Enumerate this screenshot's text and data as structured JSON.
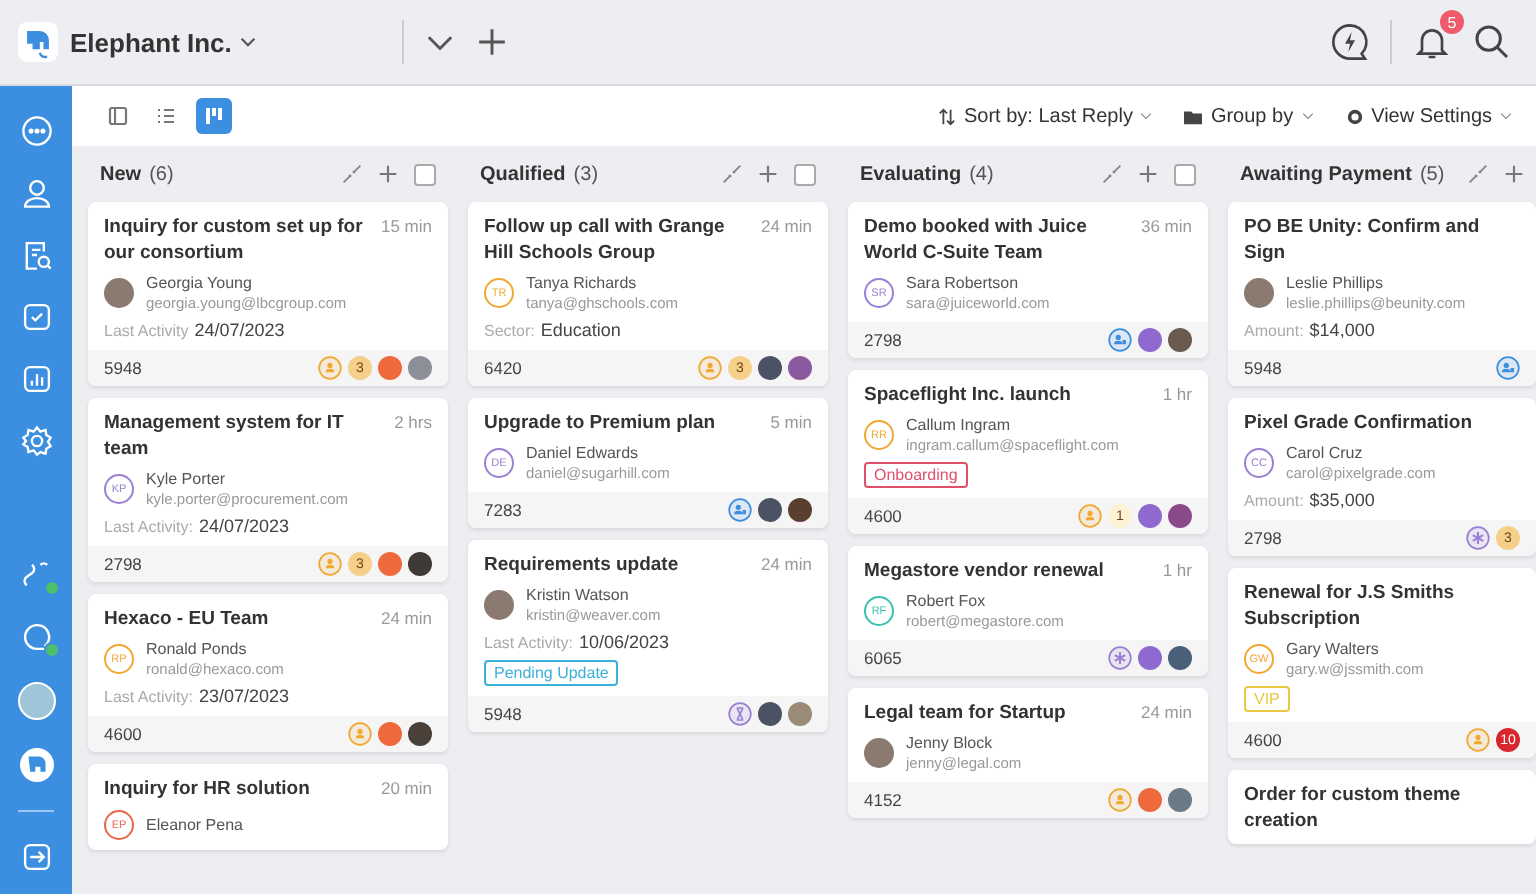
{
  "workspace": {
    "name": "Elephant Inc."
  },
  "notifications": {
    "count": "5"
  },
  "toolbar": {
    "views": [
      {
        "kind": "panel",
        "selected": false
      },
      {
        "kind": "list",
        "selected": false
      },
      {
        "kind": "board",
        "selected": true
      }
    ],
    "sort": "Sort by: Last Reply",
    "group": "Group by",
    "settings": "View Settings"
  },
  "sidebar": {
    "items": [
      {
        "kind": "chat",
        "selected": false
      },
      {
        "kind": "user",
        "selected": false
      },
      {
        "kind": "search-doc",
        "selected": false
      },
      {
        "kind": "check",
        "selected": false
      },
      {
        "kind": "chart",
        "selected": false
      },
      {
        "kind": "gear",
        "selected": false
      }
    ],
    "bottom": [
      {
        "kind": "link",
        "online": true
      },
      {
        "kind": "chat",
        "online": true
      },
      {
        "kind": "avatar",
        "online": false
      },
      {
        "kind": "logo",
        "online": false
      }
    ]
  },
  "columns": [
    {
      "title": "New",
      "count": "(6)",
      "checked": false,
      "cards": [
        {
          "title": "Inquiry for custom set up for our consortium",
          "time": "15 min",
          "contact": {
            "kind": "photo",
            "name": "Georgia Young",
            "email": "georgia.young@lbcgroup.com"
          },
          "meta": {
            "label": "Last Activity",
            "value": "24/07/2023"
          },
          "id": "5948",
          "badges": [
            {
              "kind": "person",
              "color": "#f0a830"
            },
            {
              "kind": "count",
              "text": "3",
              "color": "#f6d08a"
            },
            {
              "kind": "avatar",
              "color": "#ee6a3c"
            },
            {
              "kind": "photo",
              "color": "#8a8f98"
            }
          ]
        },
        {
          "title": "Management system for IT team",
          "time": "2 hrs",
          "contact": {
            "kind": "initials",
            "initials": "KP",
            "color": "#9b7fd4",
            "name": "Kyle Porter",
            "email": "kyle.porter@procurement.com"
          },
          "meta": {
            "label": "Last Activity:",
            "value": "24/07/2023"
          },
          "id": "2798",
          "badges": [
            {
              "kind": "person",
              "color": "#f0a830"
            },
            {
              "kind": "count",
              "text": "3",
              "color": "#f6d08a"
            },
            {
              "kind": "avatar",
              "color": "#ee6a3c"
            },
            {
              "kind": "photo",
              "color": "#3e3a38"
            }
          ]
        },
        {
          "title": "Hexaco - EU Team",
          "time": "24 min",
          "contact": {
            "kind": "initials",
            "initials": "RP",
            "color": "#f0a830",
            "name": "Ronald Ponds",
            "email": "ronald@hexaco.com"
          },
          "meta": {
            "label": "Last Activity:",
            "value": "23/07/2023"
          },
          "id": "4600",
          "badges": [
            {
              "kind": "person",
              "color": "#f0a830"
            },
            {
              "kind": "avatar",
              "color": "#ee6a3c"
            },
            {
              "kind": "photo",
              "color": "#4a4038"
            }
          ]
        },
        {
          "title": "Inquiry for HR solution",
          "time": "20 min",
          "contact": {
            "kind": "initials",
            "initials": "EP",
            "color": "#e8674a",
            "name": "Eleanor Pena"
          }
        }
      ]
    },
    {
      "title": "Qualified",
      "count": "(3)",
      "checked": false,
      "cards": [
        {
          "title": "Follow up call with Grange Hill Schools Group",
          "time": "24 min",
          "contact": {
            "kind": "initials",
            "initials": "TR",
            "color": "#f0a830",
            "name": "Tanya Richards",
            "email": "tanya@ghschools.com"
          },
          "meta": {
            "label": "Sector:",
            "value": "Education"
          },
          "id": "6420",
          "badges": [
            {
              "kind": "person",
              "color": "#f0a830"
            },
            {
              "kind": "count",
              "text": "3",
              "color": "#f6d08a"
            },
            {
              "kind": "avatar",
              "color": "#4a5263"
            },
            {
              "kind": "photo",
              "color": "#8a5aa0"
            }
          ]
        },
        {
          "title": "Upgrade to Premium plan",
          "time": "5 min",
          "contact": {
            "kind": "initials",
            "initials": "DE",
            "color": "#9b7fd4",
            "name": "Daniel Edwards",
            "email": "daniel@sugarhill.com"
          },
          "id": "7283",
          "badges": [
            {
              "kind": "team",
              "color": "#3b8ee0"
            },
            {
              "kind": "avatar",
              "color": "#4a5263"
            },
            {
              "kind": "photo",
              "color": "#5a3e30"
            }
          ]
        },
        {
          "title": "Requirements update",
          "time": "24 min",
          "contact": {
            "kind": "photo",
            "name": "Kristin Watson",
            "email": "kristin@weaver.com"
          },
          "meta": {
            "label": "Last Activity:",
            "value": "10/06/2023"
          },
          "tag": {
            "text": "Pending Update",
            "color": "#3bb0d8"
          },
          "id": "5948",
          "badges": [
            {
              "kind": "hourglass",
              "color": "#9b7fd4"
            },
            {
              "kind": "avatar",
              "color": "#4a5263"
            },
            {
              "kind": "photo",
              "color": "#9a8a78"
            }
          ]
        }
      ]
    },
    {
      "title": "Evaluating",
      "count": "(4)",
      "checked": false,
      "cards": [
        {
          "title": "Demo booked with Juice World C-Suite Team",
          "time": "36 min",
          "contact": {
            "kind": "initials",
            "initials": "SR",
            "color": "#9b7fd4",
            "name": "Sara Robertson",
            "email": "sara@juiceworld.com"
          },
          "id": "2798",
          "badges": [
            {
              "kind": "team",
              "color": "#3b8ee0"
            },
            {
              "kind": "avatar",
              "color": "#8e6ad0"
            },
            {
              "kind": "photo",
              "color": "#6a5a50"
            }
          ]
        },
        {
          "title": "Spaceflight Inc. launch",
          "time": "1 hr",
          "contact": {
            "kind": "initials",
            "initials": "RR",
            "color": "#f0a830",
            "name": "Callum Ingram",
            "email": "ingram.callum@spaceflight.com"
          },
          "tag": {
            "text": "Onboarding",
            "color": "#e0506a"
          },
          "id": "4600",
          "badges": [
            {
              "kind": "person",
              "color": "#f0a830"
            },
            {
              "kind": "count",
              "text": "1",
              "color": "#fdf1d6"
            },
            {
              "kind": "avatar",
              "color": "#8e6ad0"
            },
            {
              "kind": "photo",
              "color": "#8a4a8a"
            }
          ]
        },
        {
          "title": "Megastore vendor renewal",
          "time": "1 hr",
          "contact": {
            "kind": "initials",
            "initials": "RF",
            "color": "#3bbfb0",
            "name": "Robert Fox",
            "email": "robert@megastore.com"
          },
          "id": "6065",
          "badges": [
            {
              "kind": "asterisk",
              "color": "#9b7fd4"
            },
            {
              "kind": "avatar",
              "color": "#8e6ad0"
            },
            {
              "kind": "photo",
              "color": "#4a6078"
            }
          ]
        },
        {
          "title": "Legal team for Startup",
          "time": "24 min",
          "contact": {
            "kind": "photo",
            "name": "Jenny Block",
            "email": "jenny@legal.com"
          },
          "id": "4152",
          "badges": [
            {
              "kind": "person",
              "color": "#f0a830"
            },
            {
              "kind": "avatar",
              "color": "#ee6a3c"
            },
            {
              "kind": "photo",
              "color": "#6a7a88"
            }
          ]
        }
      ]
    },
    {
      "title": "Awaiting Payment",
      "count": "(5)",
      "cards": [
        {
          "title": "PO BE Unity: Confirm and Sign",
          "contact": {
            "kind": "photo",
            "name": "Leslie Phillips",
            "email": "leslie.phillips@beunity.com"
          },
          "meta": {
            "label": "Amount:",
            "value": "$14,000"
          },
          "id": "5948",
          "badges": [
            {
              "kind": "team",
              "color": "#3b8ee0"
            }
          ]
        },
        {
          "title": "Pixel Grade Confirmation",
          "contact": {
            "kind": "initials",
            "initials": "CC",
            "color": "#9b7fd4",
            "name": "Carol Cruz",
            "email": "carol@pixelgrade.com"
          },
          "meta": {
            "label": "Amount:",
            "value": "$35,000"
          },
          "id": "2798",
          "badges": [
            {
              "kind": "asterisk",
              "color": "#9b7fd4"
            },
            {
              "kind": "count",
              "text": "3",
              "color": "#f6d08a"
            }
          ]
        },
        {
          "title": "Renewal for J.S Smiths Subscription",
          "contact": {
            "kind": "initials",
            "initials": "GW",
            "color": "#f0a830",
            "name": "Gary Walters",
            "email": "gary.w@jssmith.com"
          },
          "tag": {
            "text": "VIP",
            "color": "#e8c840"
          },
          "id": "4600",
          "badges": [
            {
              "kind": "person",
              "color": "#f0a830"
            },
            {
              "kind": "count",
              "text": "10",
              "color": "#d8262e"
            }
          ]
        },
        {
          "title": "Order for custom theme creation"
        }
      ]
    }
  ]
}
